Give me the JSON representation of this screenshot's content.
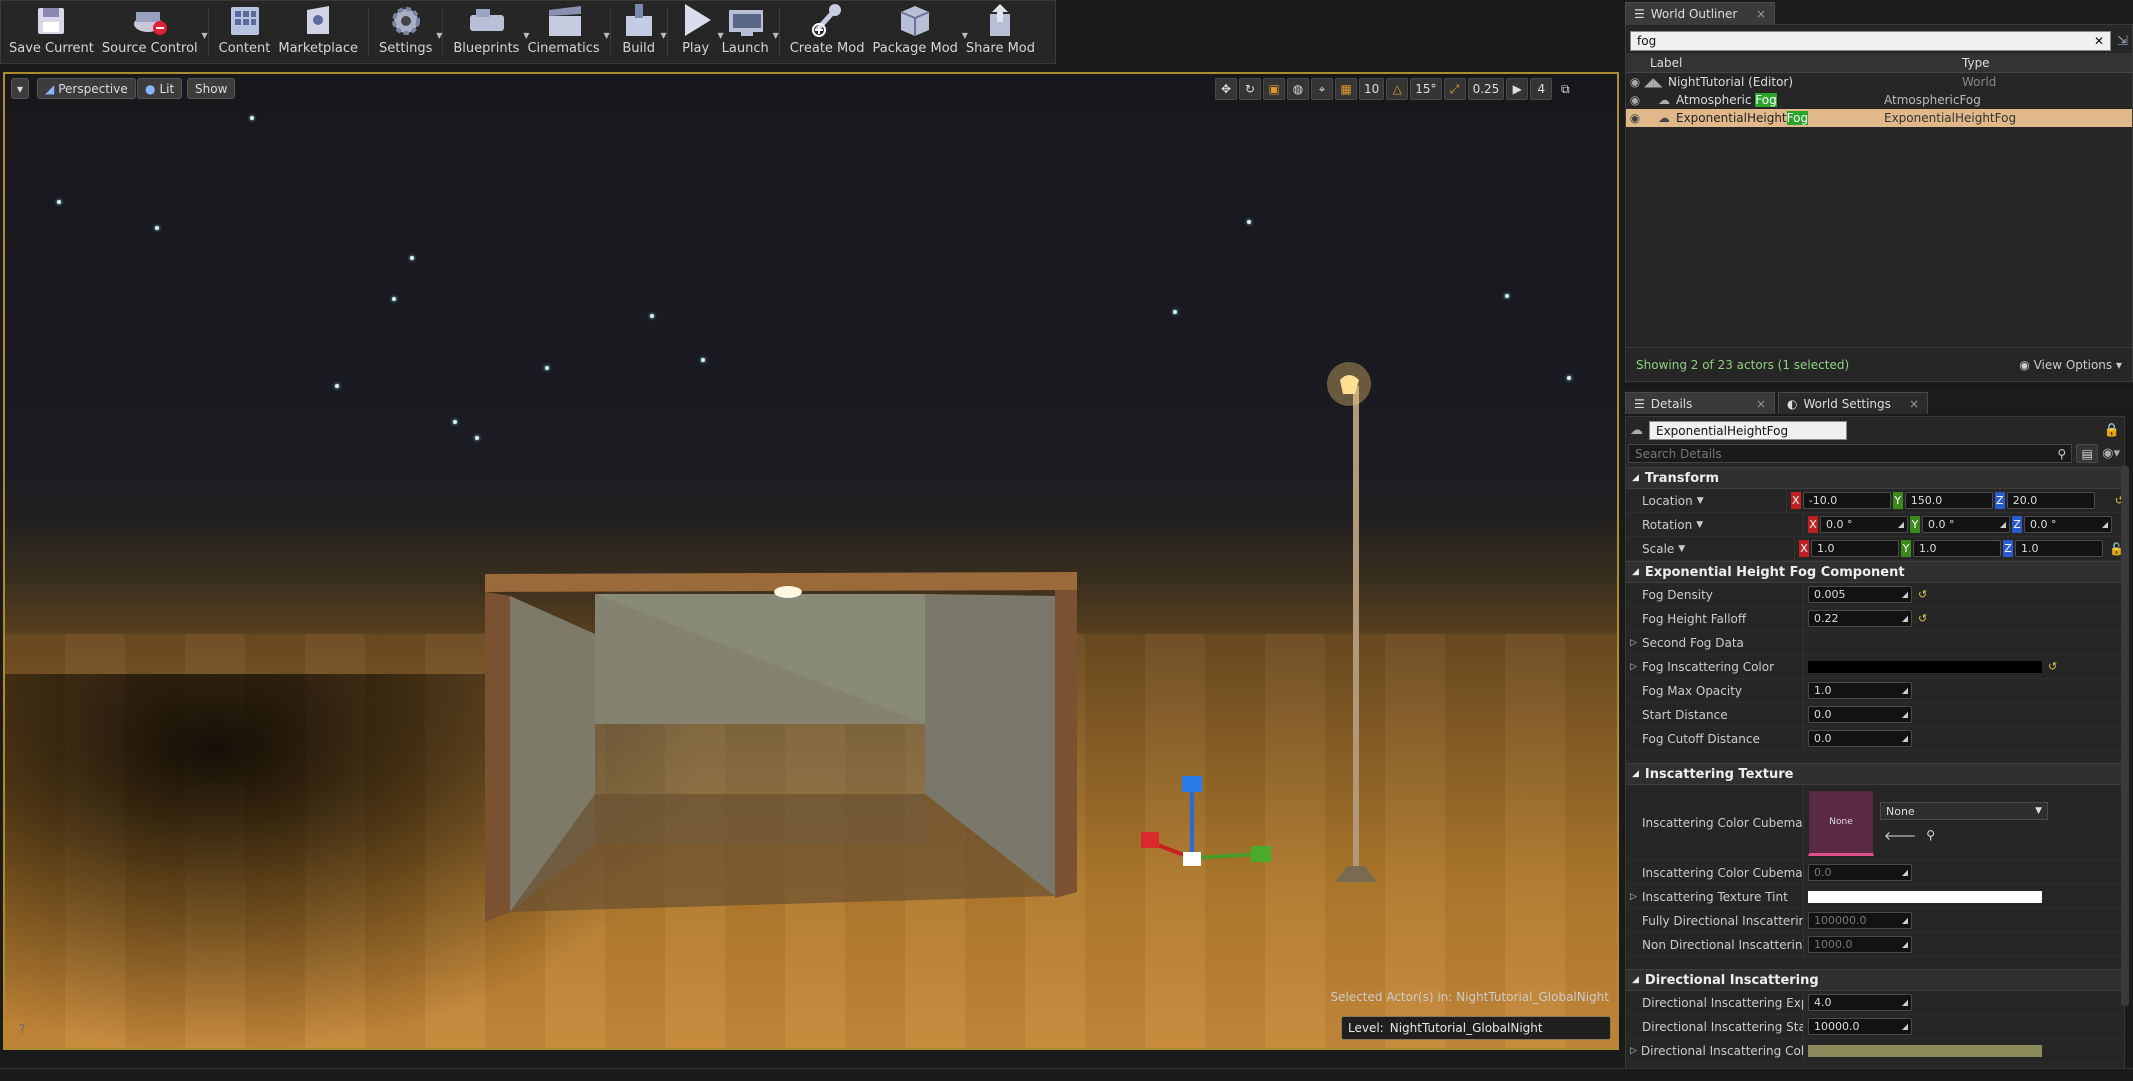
{
  "toolbar": {
    "buttons": [
      {
        "label": "Save Current",
        "icon": "save-icon",
        "dropdown": false
      },
      {
        "label": "Source Control",
        "icon": "source-control-icon",
        "dropdown": true
      },
      {
        "label": "Content",
        "icon": "content-icon",
        "dropdown": false
      },
      {
        "label": "Marketplace",
        "icon": "marketplace-icon",
        "dropdown": false
      },
      {
        "label": "Settings",
        "icon": "gear-icon",
        "dropdown": true
      },
      {
        "label": "Blueprints",
        "icon": "blueprint-icon",
        "dropdown": true
      },
      {
        "label": "Cinematics",
        "icon": "clapper-icon",
        "dropdown": true
      },
      {
        "label": "Build",
        "icon": "build-icon",
        "dropdown": true
      },
      {
        "label": "Play",
        "icon": "play-icon",
        "dropdown": true
      },
      {
        "label": "Launch",
        "icon": "launch-icon",
        "dropdown": true
      },
      {
        "label": "Create Mod",
        "icon": "create-mod-icon",
        "dropdown": false
      },
      {
        "label": "Package Mod",
        "icon": "package-icon",
        "dropdown": true
      },
      {
        "label": "Share Mod",
        "icon": "share-icon",
        "dropdown": false
      }
    ]
  },
  "viewport": {
    "perspective_label": "Perspective",
    "lit_label": "Lit",
    "show_label": "Show",
    "grid_snap": "10",
    "rot_snap": "15°",
    "scale_snap": "0.25",
    "camera_speed": "4",
    "selected_info": "Selected Actor(s) in:  NightTutorial_GlobalNight",
    "level_label": "Level:",
    "level_name": "NightTutorial_GlobalNight"
  },
  "outliner": {
    "tab_label": "World Outliner",
    "search_value": "fog",
    "col_label": "Label",
    "col_type": "Type",
    "rows": [
      {
        "pre": "NightTutorial (Editor)",
        "hl": "",
        "type": "World",
        "selected": false
      },
      {
        "pre": "Atmospheric ",
        "hl": "Fog",
        "type": "AtmosphericFog",
        "selected": false
      },
      {
        "pre": "ExponentialHeight",
        "hl": "Fog",
        "type": "ExponentialHeightFog",
        "selected": true
      }
    ],
    "status": "Showing 2 of 23 actors (1 selected)",
    "view_options": "View Options"
  },
  "details": {
    "tab_details": "Details",
    "tab_world": "World Settings",
    "name_value": "ExponentialHeightFog",
    "search_placeholder": "Search Details",
    "transform_title": "Transform",
    "location_label": "Location",
    "rotation_label": "Rotation",
    "scale_label": "Scale",
    "location": {
      "x": "-10.0",
      "y": "150.0",
      "z": "20.0"
    },
    "rotation": {
      "x": "0.0 °",
      "y": "0.0 °",
      "z": "0.0 °"
    },
    "scale": {
      "x": "1.0",
      "y": "1.0",
      "z": "1.0"
    },
    "fog_title": "Exponential Height Fog Component",
    "fog_density_label": "Fog Density",
    "fog_density": "0.005",
    "fog_falloff_label": "Fog Height Falloff",
    "fog_falloff": "0.22",
    "second_fog_label": "Second Fog Data",
    "fog_inscatter_label": "Fog Inscattering Color",
    "fog_max_opacity_label": "Fog Max Opacity",
    "fog_max_opacity": "1.0",
    "start_distance_label": "Start Distance",
    "start_distance": "0.0",
    "fog_cutoff_label": "Fog Cutoff Distance",
    "fog_cutoff": "0.0",
    "inscatter_tex_title": "Inscattering Texture",
    "cubemap_label": "Inscattering Color Cubemap",
    "cubemap_thumb": "None",
    "cubemap_select": "None",
    "cubemap_angle_label": "Inscattering Color Cubemap An",
    "cubemap_angle": "0.0",
    "tex_tint_label": "Inscattering Texture Tint",
    "fully_dir_label": "Fully Directional Inscattering Co",
    "fully_dir": "100000.0",
    "non_dir_label": "Non Directional Inscattering Co",
    "non_dir": "1000.0",
    "dir_title": "Directional Inscattering",
    "dir_exp_label": "Directional Inscattering Expone",
    "dir_exp": "4.0",
    "dir_start_label": "Directional Inscattering Start D",
    "dir_start": "10000.0",
    "dir_color_label": "Directional Inscattering Color"
  },
  "colors": {
    "accent": "#b08a2e",
    "selection": "#e0b88a",
    "highlight": "#2aa52a"
  }
}
